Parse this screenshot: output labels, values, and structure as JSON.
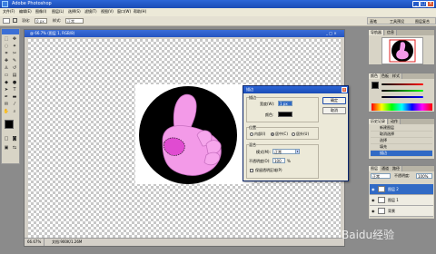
{
  "app": {
    "title": "Adobe Photoshop"
  },
  "menu": [
    "文件(F)",
    "编辑(E)",
    "图像(I)",
    "图层(L)",
    "选择(S)",
    "滤镜(T)",
    "视图(V)",
    "窗口(W)",
    "帮助(H)"
  ],
  "options": {
    "feather_label": "羽化:",
    "feather_value": "0 px",
    "style_label": "样式:",
    "style_value": "正常",
    "palette_tabs": [
      "画笔",
      "工具预设",
      "图层复合"
    ]
  },
  "document": {
    "title": "@ 66.7% (图层 1, RGB/8)",
    "zoom": "66.67%",
    "doc_info": "文档:900K/1.26M"
  },
  "dialog": {
    "title": "描边",
    "stroke_group": "描边",
    "width_label": "宽度(W):",
    "width_value": "1 px",
    "color_label": "颜色:",
    "location_group": "位置",
    "location_options": [
      "内部(I)",
      "居中(C)",
      "居外(U)"
    ],
    "location_selected": 1,
    "blend_group": "混合",
    "mode_label": "模式(M):",
    "mode_value": "正常",
    "opacity_label": "不透明度(O):",
    "opacity_value": "100",
    "opacity_unit": "%",
    "preserve_label": "保留透明区域(P)",
    "ok_label": "确定",
    "cancel_label": "取消"
  },
  "navigator": {
    "tabs": [
      "导航器",
      "信息"
    ]
  },
  "color_panel": {
    "tabs": [
      "颜色",
      "色板",
      "样式"
    ]
  },
  "history": {
    "tabs": [
      "历史记录",
      "动作"
    ],
    "items": [
      "新建图层",
      "取消选择",
      "选择",
      "填充",
      "描边"
    ]
  },
  "layers": {
    "tabs": [
      "图层",
      "通道",
      "路径"
    ],
    "blend_mode": "正常",
    "opacity_label": "不透明度:",
    "opacity_value": "100%",
    "items": [
      "图层 2",
      "图层 1",
      "背景"
    ],
    "selected": 0
  },
  "watermark": "Baidu经验",
  "colors": {
    "title_blue": "#1a4bb5",
    "hand_pink": "#f39ae8",
    "dark_pink": "#e04bd1",
    "circle": "#000000"
  }
}
